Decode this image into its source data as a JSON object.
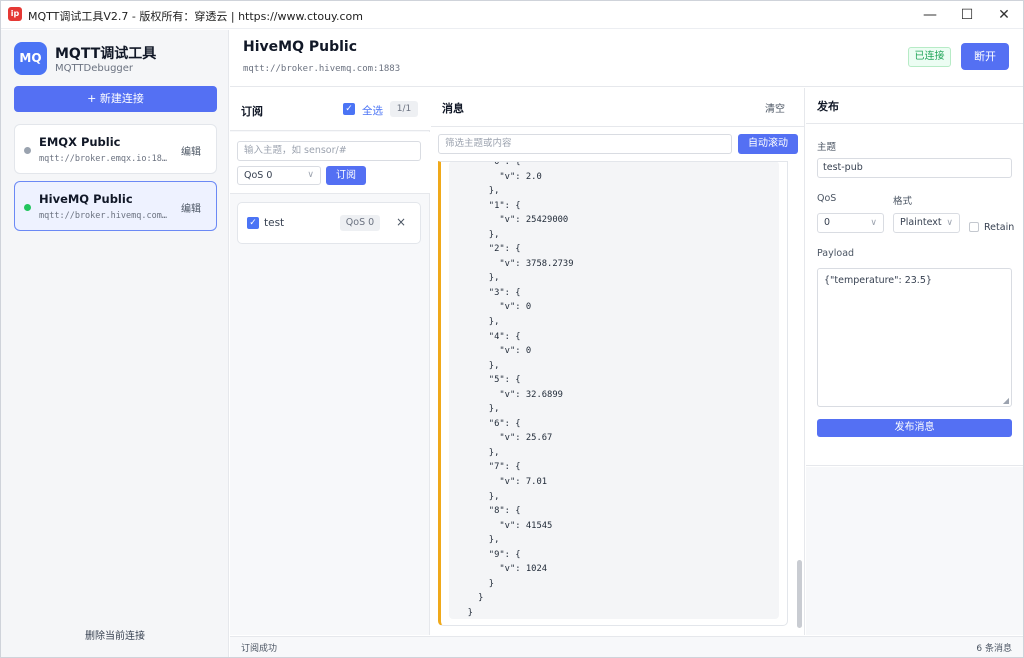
{
  "window": {
    "title": "MQTT调试工具V2.7 - 版权所有：穿透云 | https://www.ctouy.com",
    "icon_text": "ip",
    "controls": {
      "minimize": "—",
      "maximize": "☐",
      "close": "✕"
    }
  },
  "sidebar": {
    "logo_text": "MQ",
    "app_name": "MQTT调试工具",
    "app_sub": "MQTTDebugger",
    "new_connection": "+ 新建连接",
    "connections": [
      {
        "name": "EMQX Public",
        "url": "mqtt://broker.emqx.io:1883",
        "edit": "编辑",
        "active": false
      },
      {
        "name": "HiveMQ Public",
        "url": "mqtt://broker.hivemq.com:1883",
        "edit": "编辑",
        "active": true
      }
    ],
    "delete_connection": "删除当前连接"
  },
  "header": {
    "title": "HiveMQ Public",
    "url": "mqtt://broker.hivemq.com:1883",
    "status": "已连接",
    "disconnect": "断开"
  },
  "subscribe": {
    "title": "订阅",
    "select_all": "全选",
    "count": "1/1",
    "topic_placeholder": "输入主题，如 sensor/#",
    "qos": "QoS 0",
    "subscribe_button": "订阅",
    "items": [
      {
        "topic": "test",
        "qos": "QoS 0",
        "remove": "×"
      }
    ]
  },
  "messages": {
    "title": "消息",
    "clear": "清空",
    "filter_placeholder": "筛选主题或内容",
    "autoscroll": "自动滚动",
    "payload_text": "      \"0\": {\n        \"v\": 2.0\n      },\n      \"1\": {\n        \"v\": 25429000\n      },\n      \"2\": {\n        \"v\": 3758.2739\n      },\n      \"3\": {\n        \"v\": 0\n      },\n      \"4\": {\n        \"v\": 0\n      },\n      \"5\": {\n        \"v\": 32.6899\n      },\n      \"6\": {\n        \"v\": 25.67\n      },\n      \"7\": {\n        \"v\": 7.01\n      },\n      \"8\": {\n        \"v\": 41545\n      },\n      \"9\": {\n        \"v\": 1024\n      }\n    }\n  }\n]\n}"
  },
  "publish": {
    "title": "发布",
    "topic_label": "主题",
    "topic_value": "test-pub",
    "qos_label": "QoS",
    "qos_value": "0",
    "format_label": "格式",
    "format_value": "Plaintext",
    "retain_label": "Retain",
    "payload_label": "Payload",
    "payload_value": "{\"temperature\": 23.5}",
    "publish_button": "发布消息"
  },
  "statusbar": {
    "left": "订阅成功",
    "right": "6 条消息"
  },
  "colors": {
    "accent": "#5470f3",
    "connected": "#22c55e",
    "message_border": "#f0a91a"
  }
}
